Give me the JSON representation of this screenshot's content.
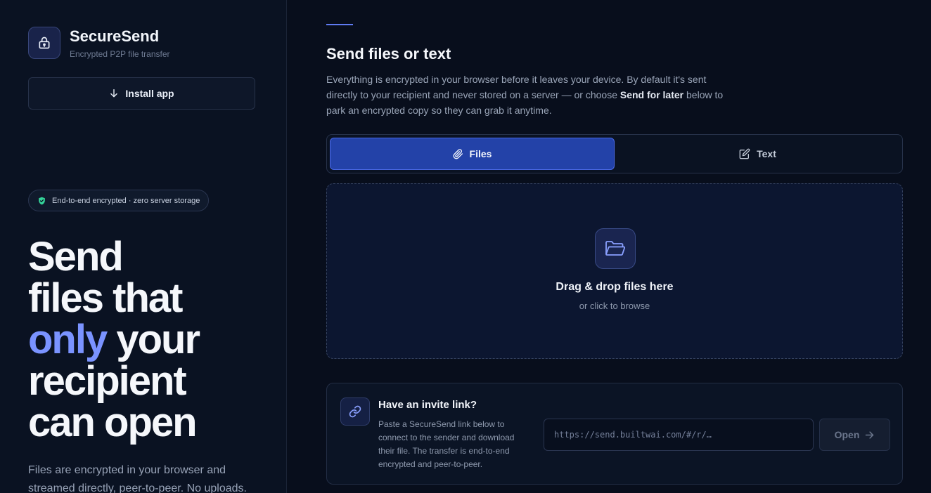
{
  "brand": {
    "name": "SecureSend",
    "tagline": "Encrypted P2P file transfer",
    "logo_icon": "lock-icon"
  },
  "sidebar": {
    "install_label": "Install app",
    "install_icon": "download-arrow-icon",
    "badge_text": "End-to-end encrypted · zero server storage",
    "badge_icon": "shield-check-icon",
    "hero": {
      "line1": "Send",
      "line2": "files that",
      "accent": "only",
      "line3_rest": " your",
      "line4": "recipient",
      "line5": "can open"
    },
    "subtitle": "Files are encrypted in your browser and streamed directly, peer-to-peer. No uploads."
  },
  "main": {
    "title": "Send files or text",
    "desc_part1": "Everything is encrypted in your browser before it leaves your device. By default it's sent directly to your recipient and never stored on a server — or choose ",
    "desc_bold": "Send for later",
    "desc_part2": " below to park an encrypted copy so they can grab it anytime.",
    "tabs": [
      {
        "label": "Files",
        "icon": "paperclip-icon",
        "active": true
      },
      {
        "label": "Text",
        "icon": "edit-icon",
        "active": false
      }
    ],
    "dropzone": {
      "icon": "folder-open-icon",
      "title": "Drag & drop files here",
      "subtitle": "or click to browse"
    },
    "invite": {
      "icon": "link-icon",
      "title": "Have an invite link?",
      "description": "Paste a SecureSend link below to connect to the sender and download their file. The transfer is end-to-end encrypted and peer-to-peer.",
      "input_placeholder": "https://send.builtwai.com/#/r/…",
      "input_value": "",
      "open_label": "Open",
      "open_icon": "arrow-right-icon"
    }
  },
  "colors": {
    "background": "#080e1c",
    "sidebar": "#0a1222",
    "accent": "#7a93ff",
    "active_tab": "#2342a8",
    "badge_shield": "#34d399"
  }
}
